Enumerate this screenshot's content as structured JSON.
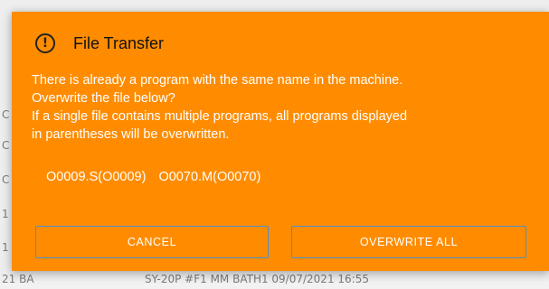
{
  "background": {
    "rows": [
      {
        "left": "C",
        "text": ""
      },
      {
        "left": "C",
        "text": ""
      },
      {
        "left": "C",
        "text": ""
      },
      {
        "left": "1",
        "text": ""
      },
      {
        "left": "1",
        "text": ""
      },
      {
        "left": "21 BA",
        "text": "SY-20P #F1 MM BATH1       09/07/2021 16:55"
      }
    ]
  },
  "dialog": {
    "title": "File Transfer",
    "icon": "warning-circle-icon",
    "message_lines": [
      "There is already a program with the same name in the machine.",
      "Overwrite the file below?",
      "If a single file contains multiple programs, all programs displayed",
      "in parentheses will be overwritten."
    ],
    "files": [
      "O0009.S(O0009)",
      "O0070.M(O0070)"
    ],
    "buttons": {
      "cancel": "CANCEL",
      "overwrite_all": "OVERWRITE ALL"
    }
  },
  "colors": {
    "dialog_background": "#ff8c00",
    "button_border": "#4a90c8",
    "text": "#ffffff"
  }
}
